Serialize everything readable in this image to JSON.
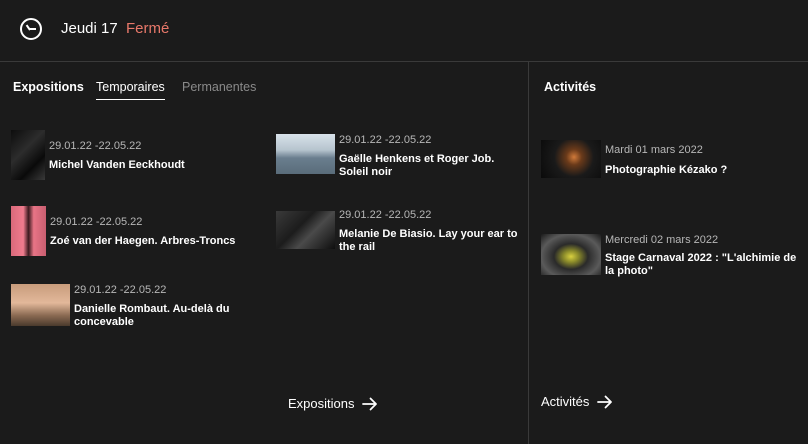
{
  "header": {
    "day": "Jeudi 17",
    "status": "Fermé",
    "status_color": "#e8786a",
    "icon": "clock-icon"
  },
  "tabs": [
    {
      "label": "Expositions",
      "active": true
    },
    {
      "label": "Temporaires",
      "active": true
    },
    {
      "label": "Permanentes",
      "active": false
    }
  ],
  "expositions": [
    {
      "date": "29.01.22 -22.05.22",
      "title": "Michel Vanden Eeckhoudt"
    },
    {
      "date": "29.01.22 -22.05.22",
      "title": "Zoé van der Haegen. Arbres-Troncs"
    },
    {
      "date": "29.01.22 -22.05.22",
      "title": "Danielle Rombaut. Au-delà du concevable"
    },
    {
      "date": "29.01.22 -22.05.22",
      "title": "Gaëlle Henkens et Roger Job. Soleil noir"
    },
    {
      "date": "29.01.22 -22.05.22",
      "title": "Melanie De Biasio. Lay your ear to the rail"
    }
  ],
  "expositions_link": "Expositions",
  "activites": {
    "title": "Activités",
    "items": [
      {
        "date": "Mardi 01 mars 2022",
        "title": "Photographie Kézako ?"
      },
      {
        "date": "Mercredi 02 mars 2022",
        "title": "Stage Carnaval 2022 : \"L'alchimie de la photo\""
      }
    ],
    "link": "Activités"
  }
}
